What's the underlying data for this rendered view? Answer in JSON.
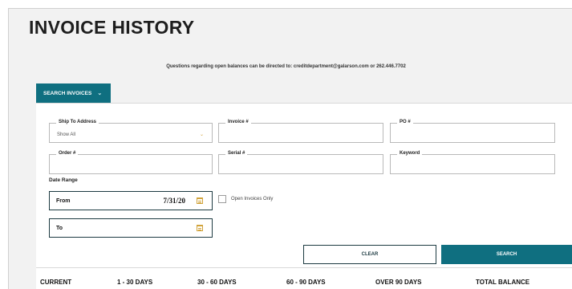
{
  "page": {
    "title": "INVOICE HISTORY",
    "contact_note": "Questions regarding open balances can be directed to: creditdepartment@galarson.com or 262.446.7702"
  },
  "search_tab": {
    "label": "SEARCH INVOICES",
    "icon": "chevron-down-icon"
  },
  "filters": {
    "ship_to": {
      "label": "Ship To Address",
      "value": "Show All"
    },
    "invoice_no": {
      "label": "Invoice #",
      "value": ""
    },
    "po_no": {
      "label": "PO #",
      "value": ""
    },
    "order_no": {
      "label": "Order #",
      "value": ""
    },
    "serial_no": {
      "label": "Serial #",
      "value": ""
    },
    "keyword": {
      "label": "Keyword",
      "value": ""
    }
  },
  "date_range": {
    "label": "Date Range",
    "from_label": "From",
    "from_value": "7/31/20",
    "to_label": "To",
    "to_value": ""
  },
  "open_invoices_only": {
    "label": "Open Invoices Only",
    "checked": false
  },
  "buttons": {
    "clear": "CLEAR",
    "search": "SEARCH"
  },
  "aging_columns": [
    "CURRENT",
    "1 - 30 DAYS",
    "30 - 60 DAYS",
    "60 - 90 DAYS",
    "OVER 90 DAYS",
    "TOTAL BALANCE"
  ],
  "colors": {
    "accent": "#0f6f80",
    "icon_gold": "#d1a33b",
    "dark_border": "#1c3a41",
    "page_bg": "#f2f2f2"
  }
}
